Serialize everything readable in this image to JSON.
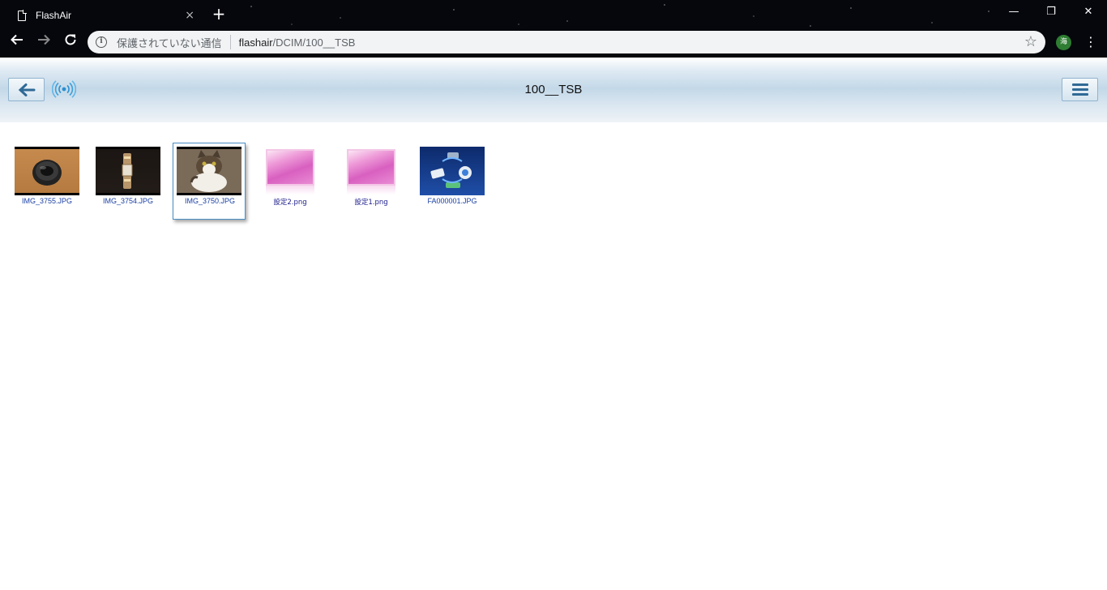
{
  "browser": {
    "tab_title": "FlashAir",
    "tab_close": "×",
    "new_tab": "+",
    "security_text": "保護されていない通信",
    "url_host": "flashair",
    "url_path": "/DCIM/100__TSB",
    "avatar_text": "海",
    "icons": {
      "back": "back-arrow-icon",
      "forward": "forward-arrow-icon",
      "reload": "reload-icon",
      "info": "info-icon",
      "star": "star-icon",
      "menu": "three-dot-menu-icon"
    },
    "window_controls": [
      "—",
      "❐",
      "✕"
    ]
  },
  "header": {
    "title": "100__TSB",
    "back_icon": "back-arrow-icon",
    "wifi_icon": "wireless-signal-icon",
    "menu_icon": "hamburger-menu-icon",
    "accent": "#2f6a96"
  },
  "files": [
    {
      "name": "IMG_3755.JPG",
      "thumb": "lens"
    },
    {
      "name": "IMG_3754.JPG",
      "thumb": "watch"
    },
    {
      "name": "IMG_3750.JPG",
      "thumb": "cat",
      "selected": true
    },
    {
      "name": "設定2.png",
      "thumb": "pink"
    },
    {
      "name": "設定1.png",
      "thumb": "pink"
    },
    {
      "name": "FA000001.JPG",
      "thumb": "flashair"
    }
  ]
}
